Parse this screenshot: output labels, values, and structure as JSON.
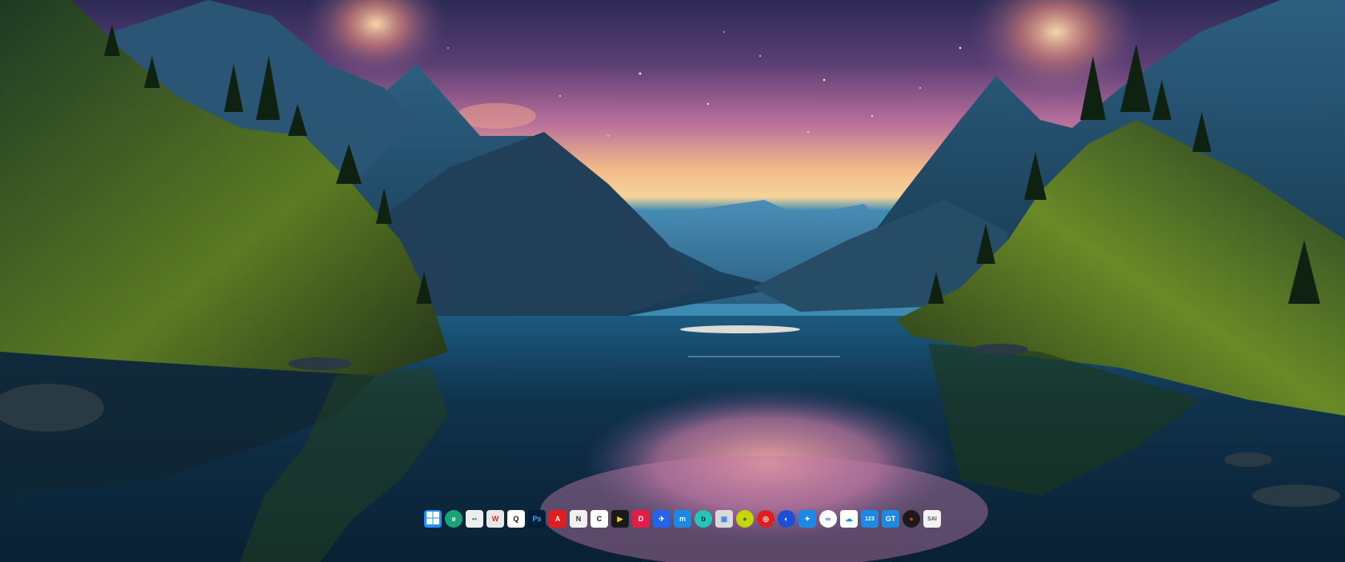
{
  "desktop": {
    "wallpaper_colors": {
      "sky_top": "#3a2f5e",
      "sky_mid": "#c77aa0",
      "horizon": "#f6c389",
      "mountain_far": "#2f6f96",
      "mountain_near": "#1f4560",
      "forest": "#2f4a1e",
      "moss": "#8ca83a",
      "lake": "#0e2c43"
    }
  },
  "taskbar": {
    "apps": [
      {
        "name": "start-button",
        "icon": "windows-logo-icon",
        "glyph": "",
        "bg": "#1e90ff",
        "fg": "#ffffff"
      },
      {
        "name": "edge-app",
        "icon": "edge-icon",
        "glyph": "e",
        "bg": "#1aa37a",
        "fg": "#ffffff"
      },
      {
        "name": "wechat-app",
        "icon": "wechat-icon",
        "glyph": "••",
        "bg": "#eeeeee",
        "fg": "#2ba245"
      },
      {
        "name": "wps-app",
        "icon": "wps-icon",
        "glyph": "W",
        "bg": "#e8e8e8",
        "fg": "#e02424"
      },
      {
        "name": "qq-app",
        "icon": "qq-penguin-icon",
        "glyph": "Q",
        "bg": "#ffffff",
        "fg": "#111111"
      },
      {
        "name": "photoshop-app",
        "icon": "photoshop-icon",
        "glyph": "Ps",
        "bg": "#001e36",
        "fg": "#31a8ff"
      },
      {
        "name": "acrobat-app",
        "icon": "acrobat-icon",
        "glyph": "A",
        "bg": "#e11d1d",
        "fg": "#ffffff"
      },
      {
        "name": "notepad-app",
        "icon": "notepad-icon",
        "glyph": "N",
        "bg": "#f0f0f0",
        "fg": "#333333"
      },
      {
        "name": "capcut-app",
        "icon": "capcut-icon",
        "glyph": "C",
        "bg": "#ffffff",
        "fg": "#111111"
      },
      {
        "name": "potplayer-app",
        "icon": "potplayer-icon",
        "glyph": "▶",
        "bg": "#1a1a1a",
        "fg": "#ffd400"
      },
      {
        "name": "lanzou-app",
        "icon": "lanzou-icon",
        "glyph": "D",
        "bg": "#e11d48",
        "fg": "#ffffff"
      },
      {
        "name": "xunlei-app",
        "icon": "xunlei-icon",
        "glyph": "✈",
        "bg": "#2563eb",
        "fg": "#ffffff"
      },
      {
        "name": "mweb-app",
        "icon": "m-icon",
        "glyph": "m",
        "bg": "#1e88e5",
        "fg": "#ffffff"
      },
      {
        "name": "bilibili-app",
        "icon": "b-circle-icon",
        "glyph": "b",
        "bg": "#21c7b8",
        "fg": "#111111"
      },
      {
        "name": "archive-app",
        "icon": "archive-icon",
        "glyph": "▣",
        "bg": "#d9d9d9",
        "fg": "#3b82f6"
      },
      {
        "name": "chrome-like-app",
        "icon": "yellow-circle-icon",
        "glyph": "●",
        "bg": "#c8d600",
        "fg": "#2e7d32"
      },
      {
        "name": "netease-music-app",
        "icon": "netease-music-icon",
        "glyph": "◎",
        "bg": "#e11d1d",
        "fg": "#ffffff"
      },
      {
        "name": "feishu-app",
        "icon": "feishu-icon",
        "glyph": "◐",
        "bg": "#1d4ed8",
        "fg": "#ffffff"
      },
      {
        "name": "bird-app",
        "icon": "bird-icon",
        "glyph": "✦",
        "bg": "#1e88e5",
        "fg": "#ffffff"
      },
      {
        "name": "baidu-netdisk-app",
        "icon": "cloud-sync-icon",
        "glyph": "∞",
        "bg": "#ffffff",
        "fg": "#2563eb"
      },
      {
        "name": "cloud-app",
        "icon": "cloud-icon",
        "glyph": "☁",
        "bg": "#ffffff",
        "fg": "#1e88e5"
      },
      {
        "name": "pan123-app",
        "icon": "123-icon",
        "glyph": "123",
        "bg": "#1e88e5",
        "fg": "#ffffff"
      },
      {
        "name": "gt-app",
        "icon": "gt-icon",
        "glyph": "GT",
        "bg": "#1e88e5",
        "fg": "#ffffff"
      },
      {
        "name": "recorder-app",
        "icon": "record-icon",
        "glyph": "●",
        "bg": "#1a1a1a",
        "fg": "#ff2020"
      },
      {
        "name": "sai-app",
        "icon": "sai-icon",
        "glyph": "SAI",
        "bg": "#f2f2f2",
        "fg": "#555555"
      }
    ]
  }
}
